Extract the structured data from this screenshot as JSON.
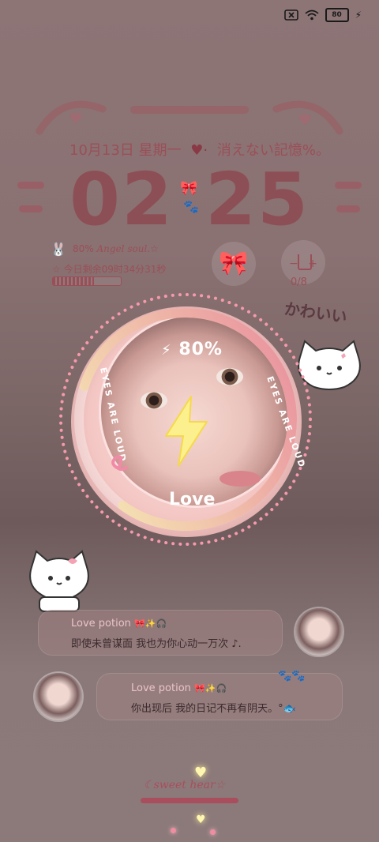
{
  "status_bar": {
    "sim_icon": "no-sim-icon",
    "wifi_icon": "wifi-icon",
    "battery_label": "80",
    "charging_icon": "lightning-icon"
  },
  "lockscreen": {
    "date": "10月13日 星期一",
    "mood": "消えない記憶%。",
    "clock_hours": "02",
    "clock_minutes": "25",
    "angel_pct": "80%",
    "angel_script": "Angel soul",
    "angel_star": ".☆",
    "countdown": "今日剩余09时34分31秒",
    "day_progress": 0.6,
    "water_count": "0/8",
    "kawaii_text": "かわいい"
  },
  "charging": {
    "percent": "80%",
    "ring_label": "Love",
    "arc_left": "EYES ARE LOUD",
    "arc_right": "EYES ARE LOUD",
    "level": 0.8
  },
  "notifications": [
    {
      "title": "Love potion",
      "title_deco": "🎀✨🎧",
      "body": "即使未曾谋面 我也为你心动一万次 ♪."
    },
    {
      "title": "Love potion",
      "title_deco": "🎀✨🎧",
      "body": "你出现后 我的日记不再有阴天。°🐟"
    }
  ],
  "footer": {
    "sweet_text": "☾sweet hear☆"
  },
  "colors": {
    "accent": "#9a4f58",
    "ring_gradient_start": "#e88a9c",
    "ring_gradient_end": "#f7f0b6",
    "dot_ring": "#f59aab"
  }
}
